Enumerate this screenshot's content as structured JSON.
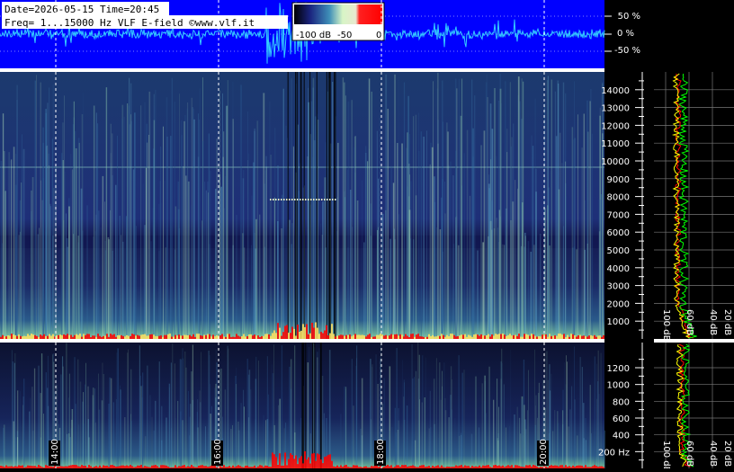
{
  "header": {
    "date_line": "Date=2026-05-15 Time=20:45",
    "freq_line": "Freq= 1...15000 Hz   VLF E-field ©www.vlf.it"
  },
  "colorbar": {
    "labels": [
      "-100 dB",
      "-50",
      "0"
    ],
    "range_db": [
      -100,
      0
    ]
  },
  "chart_data": [
    {
      "type": "line",
      "title": "",
      "ylabel": "",
      "y_ticks": [
        "50 %",
        "0 %",
        "-50 %"
      ],
      "ylim": [
        -75,
        75
      ],
      "note_color": "#00ffff"
    },
    {
      "type": "heatmap",
      "title": "",
      "x_ticks": [
        "14:00",
        "16:00",
        "18:00",
        "20:00"
      ],
      "y_ticks": [
        1000,
        2000,
        3000,
        4000,
        5000,
        6000,
        7000,
        8000,
        9000,
        10000,
        11000,
        12000,
        13000,
        14000
      ],
      "ylim": [
        0,
        15000
      ],
      "ylabel": "",
      "spectrum_ticks": [
        "100 dB",
        "60 dB",
        "40 dB",
        "20 dB"
      ]
    },
    {
      "type": "heatmap",
      "title": "",
      "x_ticks": [
        "14:00",
        "16:00",
        "18:00",
        "20:00"
      ],
      "y_ticks": [
        "200 Hz",
        400,
        600,
        800,
        1000,
        1200
      ],
      "ylim": [
        0,
        1500
      ],
      "spectrum_ticks": [
        "100 dB",
        "60 dB",
        "40 dB",
        "20 dB"
      ]
    }
  ],
  "colors": {
    "background": "#000000",
    "waveform_bg": "#0000ff",
    "waveform": "#33ccff",
    "spectro_low": "#1a237e",
    "spectro_high": "#ff0000",
    "series_green": "#00ff00",
    "series_yellow": "#ffff00",
    "series_red": "#ff0000"
  }
}
